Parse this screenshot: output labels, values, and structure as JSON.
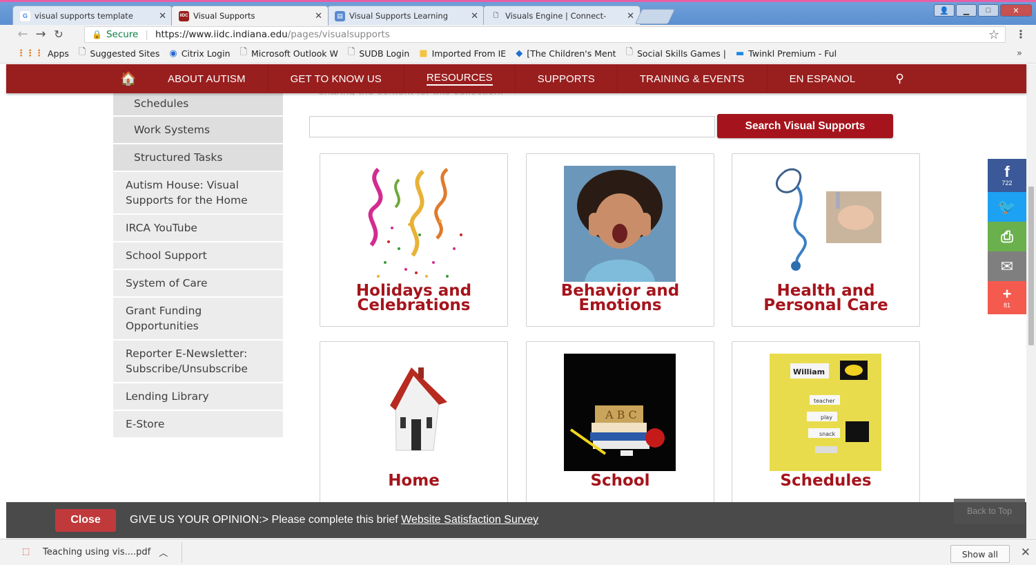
{
  "browser": {
    "tabs": [
      {
        "title": "visual supports template",
        "icon": "google-icon"
      },
      {
        "title": "Visual Supports",
        "icon": "iidc-icon"
      },
      {
        "title": "Visual Supports Learning",
        "icon": "bookmark-icon"
      },
      {
        "title": "Visuals Engine | Connect-",
        "icon": "page-icon"
      }
    ],
    "secure_label": "Secure",
    "url_host": "https://www.iidc.indiana.edu",
    "url_path": "/pages/visualsupports",
    "bookmarks": [
      "Apps",
      "Suggested Sites",
      "Citrix Login",
      "Microsoft Outlook W",
      "SUDB Login",
      "Imported From IE",
      "[The Children's Ment",
      "Social Skills Games | ",
      "Twinkl Premium - Ful"
    ],
    "more_bookmarks": "»"
  },
  "site_nav": {
    "items": [
      "ABOUT AUTISM",
      "GET TO KNOW US",
      "RESOURCES",
      "SUPPORTS",
      "TRAINING & EVENTS",
      "EN ESPANOL"
    ],
    "active": "RESOURCES"
  },
  "sidebar": {
    "items": [
      {
        "label": "Schedules",
        "sub": true
      },
      {
        "label": "Work Systems",
        "sub": true
      },
      {
        "label": "Structured Tasks",
        "sub": true
      },
      {
        "label": "Autism House: Visual Supports for the Home",
        "sub": false
      },
      {
        "label": "IRCA YouTube",
        "sub": false
      },
      {
        "label": "School Support",
        "sub": false
      },
      {
        "label": "System of Care",
        "sub": false
      },
      {
        "label": "Grant Funding Opportunities",
        "sub": false
      },
      {
        "label": "Reporter E-Newsletter: Subscribe/Unsubscribe",
        "sub": false
      },
      {
        "label": "Lending Library",
        "sub": false
      },
      {
        "label": "E-Store",
        "sub": false
      }
    ]
  },
  "main": {
    "cut_text": "sharing the content for this collection.",
    "search_button": "Search Visual Supports",
    "search_value": "",
    "cards": [
      {
        "line1": "Holidays and",
        "line2": "Celebrations"
      },
      {
        "line1": "Behavior and",
        "line2": "Emotions"
      },
      {
        "line1": "Health and",
        "line2": "Personal Care"
      },
      {
        "line1": "Home",
        "line2": ""
      },
      {
        "line1": "School",
        "line2": ""
      },
      {
        "line1": "Schedules",
        "line2": ""
      }
    ],
    "schedule_photo": {
      "name": "William",
      "words": [
        "teacher",
        "play",
        "snack"
      ]
    },
    "school_photo_letters": "A B C"
  },
  "share": {
    "facebook_count": "722",
    "plus_count": "81",
    "colors": {
      "facebook": "#3b5998",
      "twitter": "#1da1f2",
      "print": "#6ab04c",
      "email": "#7f7f7f",
      "plus": "#f45a4e"
    }
  },
  "survey": {
    "close_label": "Close",
    "text": "GIVE US YOUR OPINION:> Please complete this brief ",
    "link": "Website Satisfaction Survey",
    "back_to_top": "Back to Top"
  },
  "downloads": {
    "file": "Teaching using vis....pdf",
    "show_all": "Show all"
  },
  "colors": {
    "brand_red": "#991e1e",
    "accent_red": "#a5141c"
  }
}
